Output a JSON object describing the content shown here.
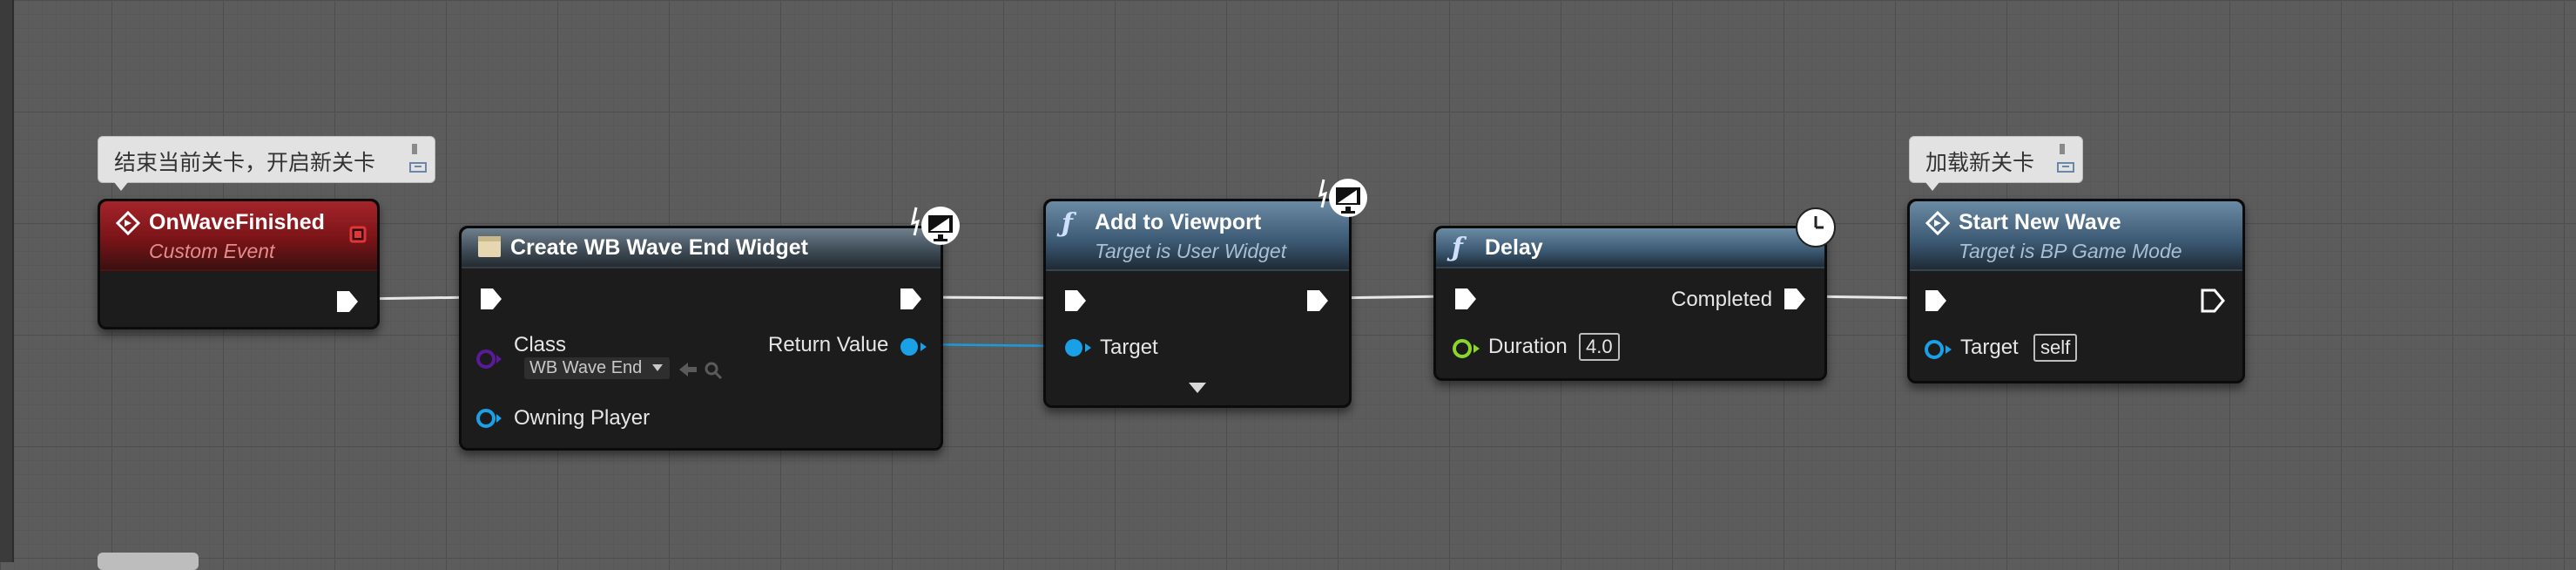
{
  "comments": [
    {
      "text": "结束当前关卡，开启新关卡"
    },
    {
      "text": "加载新关卡"
    }
  ],
  "nodes": {
    "on_wave_finished": {
      "title": "OnWaveFinished",
      "subtitle": "Custom Event",
      "header_color": "#8a1a1e"
    },
    "create_widget": {
      "title": "Create WB Wave End Widget",
      "class_label": "Class",
      "class_value": "WB Wave End",
      "return_label": "Return Value",
      "owning_label": "Owning Player",
      "header_color": "#4a5864"
    },
    "add_to_viewport": {
      "title": "Add to Viewport",
      "subtitle": "Target is User Widget",
      "target_label": "Target",
      "header_color": "#3f5f7a"
    },
    "delay": {
      "title": "Delay",
      "completed_label": "Completed",
      "duration_label": "Duration",
      "duration_value": "4.0",
      "header_color": "#3f5f7a"
    },
    "start_new_wave": {
      "title": "Start New Wave",
      "subtitle": "Target is BP Game Mode",
      "target_label": "Target",
      "target_value": "self",
      "header_color": "#3f5f7a"
    }
  },
  "colors": {
    "exec_pin": "#ffffff",
    "object_pin": "#1aa0e6",
    "class_pin": "#5a1a9a",
    "float_pin": "#8ad62a",
    "event_delegate": "#e23636",
    "grid_background": "#5c5c5c"
  }
}
